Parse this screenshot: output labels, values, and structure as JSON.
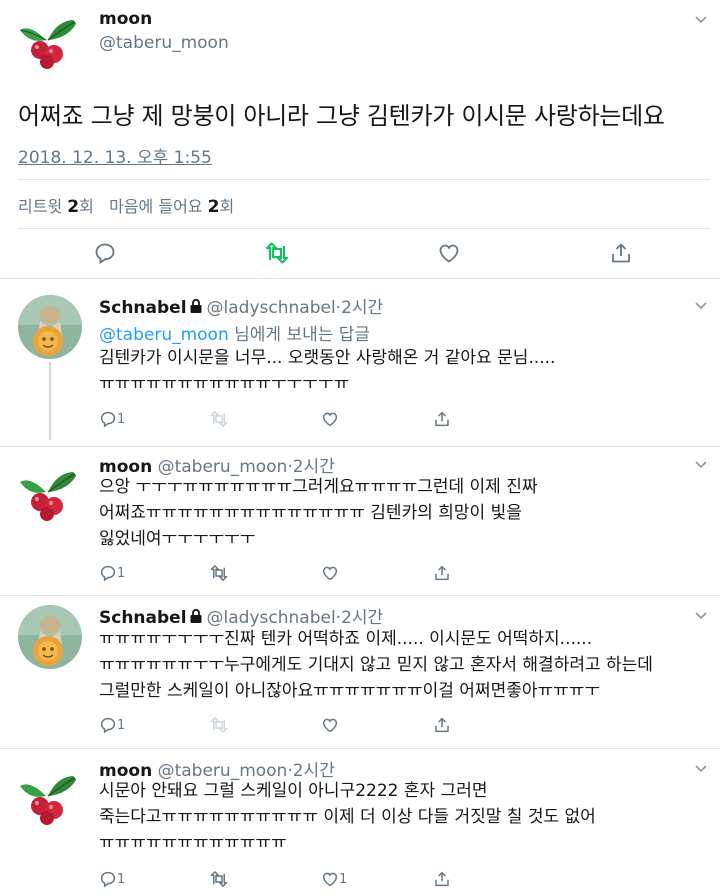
{
  "main_tweet": {
    "name": "moon",
    "handle": "@taberu_moon",
    "text": "어쩌죠 그냥 제 망붕이 아니라 그냥 김텐카가 이시문 사랑하는데요",
    "timestamp": "2018. 12. 13. 오후 1:55",
    "retweet_label": "리트윗",
    "retweet_count": "2",
    "retweet_unit": "회",
    "like_label": "마음에 들어요",
    "like_count": "2",
    "like_unit": "회"
  },
  "replies": [
    {
      "name": "Schnabel",
      "protected": true,
      "handle": "@ladyschnabel",
      "time": "·2시간",
      "reply_to_mention": "@taberu_moon",
      "reply_to_suffix": " 님에게 보내는 답글",
      "lines": [
        "김텐카가 이시문을 너무... 오랫동안 사랑해온 거 같아요 문님.....",
        "ㅠㅠㅠㅠㅠㅠㅠㅠㅠㅠㅠㅜㅜㅜㅜㅠ"
      ],
      "reply_count": "1"
    },
    {
      "name": "moon",
      "protected": false,
      "handle": "@taberu_moon",
      "time": "·2시간",
      "lines": [
        "으앙 ㅜㅜㅜㅠㅠㅠㅠㅠㅠㅠ그러게요ㅠㅠㅠㅠ그런데 이제 진짜",
        "어쩌죠ㅠㅠㅠㅠㅠㅠㅠㅠㅠㅠㅠㅠㅠㅠ 김텐카의 희망이 빛을",
        "잃었네여ㅜㅜㅜㅜㅜㅜ"
      ],
      "reply_count": "1"
    },
    {
      "name": "Schnabel",
      "protected": true,
      "handle": "@ladyschnabel",
      "time": "·2시간",
      "lines": [
        "ㅠㅠㅠㅠㅜㅜㅜㅜ진짜 텐카 어떡하죠 이제..... 이시문도 어떡하지......",
        "ㅠㅠㅠㅠㅠㅠㅜㅜ누구에게도 기대지 않고 믿지 않고 혼자서 해결하려고 하는데",
        "그럴만한 스케일이 아니잖아요ㅠㅠㅠㅠㅠㅠㅠ이걸 어쩌면좋아ㅠㅠㅠㅜ"
      ],
      "reply_count": "1"
    },
    {
      "name": "moon",
      "protected": false,
      "handle": "@taberu_moon",
      "time": "·2시간",
      "lines": [
        "시문아 안돼요 그럴 스케일이 아니구2222 혼자 그러면",
        "죽는다고ㅠㅠㅠㅠㅠㅠㅠㅠㅠㅠ 이제 더 이상 다들 거짓말 칠 것도 없어",
        "ㅠㅠㅠㅠㅠㅠㅠㅠㅠㅠㅠㅠ"
      ],
      "reply_count": "1"
    }
  ],
  "colors": {
    "accent": "#1da1f2",
    "retweet_active": "#17bf63",
    "muted": "#657786",
    "border": "#e1e8ed",
    "thread_line": "#ccd6dd"
  },
  "icons": {
    "reply": "reply-icon",
    "retweet": "retweet-icon",
    "like": "heart-icon",
    "share": "share-icon",
    "lock": "lock-icon",
    "menu": "chevron-down-icon"
  }
}
